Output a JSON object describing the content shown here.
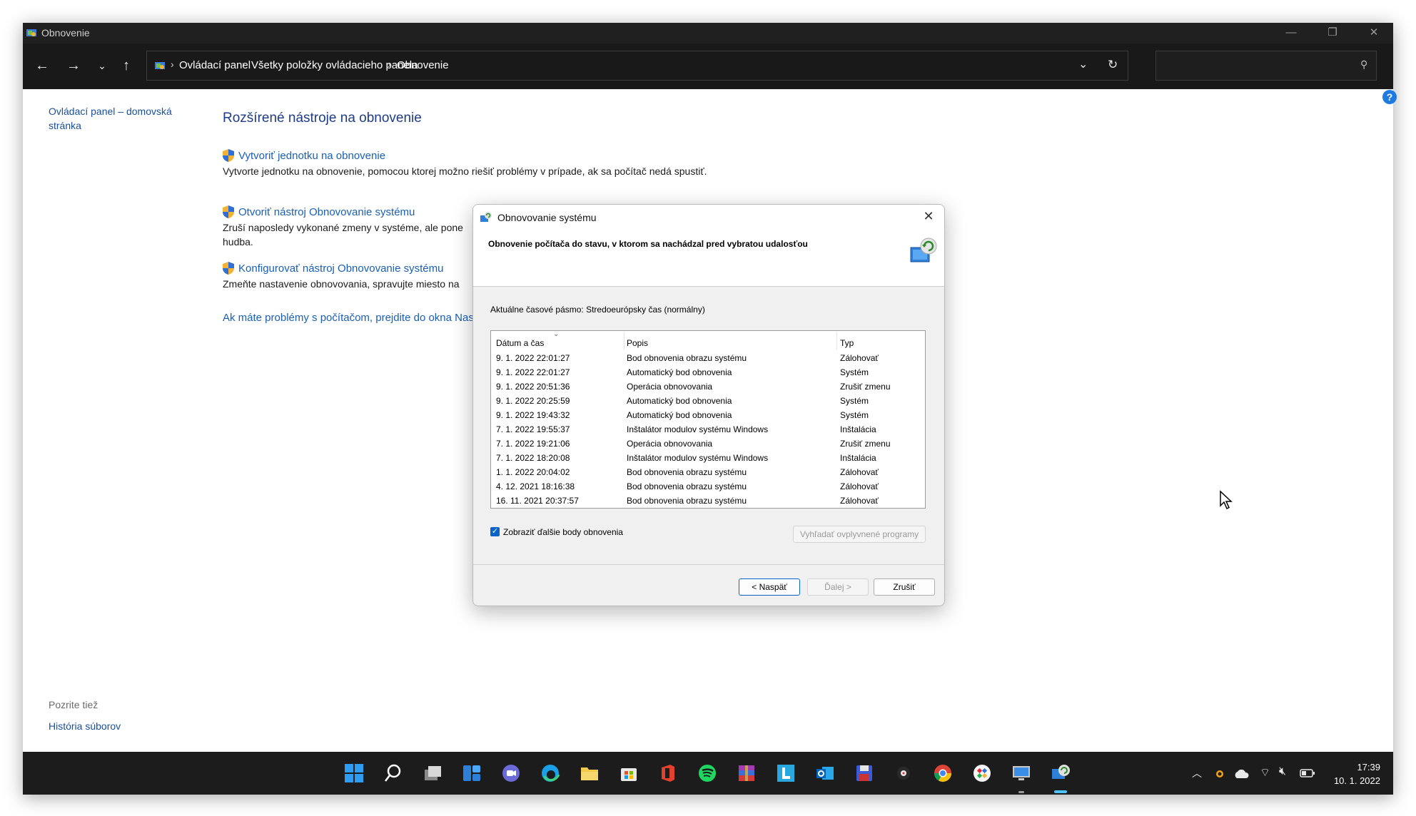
{
  "window": {
    "title": "Obnovenie"
  },
  "address_bar": {
    "crumbs": [
      "Ovládací panel",
      "Všetky položky ovládacieho panela",
      "Obnovenie"
    ],
    "search_placeholder": ""
  },
  "sidebar": {
    "home_link": "Ovládací panel – domovská stránka",
    "see_also_label": "Pozrite tiež",
    "file_history_link": "História súborov"
  },
  "main": {
    "heading": "Rozšírené nástroje na obnovenie",
    "tasks": [
      {
        "link": "Vytvoriť jednotku na obnovenie",
        "desc": "Vytvorte jednotku na obnovenie, pomocou ktorej možno riešiť problémy v prípade, ak sa počítač nedá spustiť."
      },
      {
        "link": "Otvoriť nástroj Obnovovanie systému",
        "desc_line1": "Zruší naposledy vykonané zmeny v systéme, ale pone",
        "desc_line2": "hudba."
      },
      {
        "link": "Konfigurovať nástroj Obnovovanie systému",
        "desc": "Zmeňte nastavenie obnovovania, spravujte miesto na"
      }
    ],
    "troubleshoot_link": "Ak máte problémy s počítačom, prejdite do okna Nas"
  },
  "dialog": {
    "title": "Obnovovanie systému",
    "subtitle": "Obnovenie počítača do stavu, v ktorom sa nachádzal pred vybratou udalosťou",
    "timezone": "Aktuálne časové pásmo: Stredoeurópsky čas (normálny)",
    "columns": [
      "Dátum a čas",
      "Popis",
      "Typ"
    ],
    "rows": [
      [
        "9. 1. 2022 22:01:27",
        "Bod obnovenia obrazu systému",
        "Zálohovať"
      ],
      [
        "9. 1. 2022 22:01:27",
        "Automatický bod obnovenia",
        "Systém"
      ],
      [
        "9. 1. 2022 20:51:36",
        "Operácia obnovovania",
        "Zrušiť zmenu"
      ],
      [
        "9. 1. 2022 20:25:59",
        "Automatický bod obnovenia",
        "Systém"
      ],
      [
        "9. 1. 2022 19:43:32",
        "Automatický bod obnovenia",
        "Systém"
      ],
      [
        "7. 1. 2022 19:55:37",
        "Inštalátor modulov systému Windows",
        "Inštalácia"
      ],
      [
        "7. 1. 2022 19:21:06",
        "Operácia obnovovania",
        "Zrušiť zmenu"
      ],
      [
        "7. 1. 2022 18:20:08",
        "Inštalátor modulov systému Windows",
        "Inštalácia"
      ],
      [
        "1. 1. 2022 20:04:02",
        "Bod obnovenia obrazu systému",
        "Zálohovať"
      ],
      [
        "4. 12. 2021 18:16:38",
        "Bod obnovenia obrazu systému",
        "Zálohovať"
      ],
      [
        "16. 11. 2021 20:37:57",
        "Bod obnovenia obrazu systému",
        "Zálohovať"
      ]
    ],
    "show_more_label": "Zobraziť ďalšie body obnovenia",
    "show_more_checked": true,
    "scan_button": "Vyhľadať ovplyvnené programy",
    "back_button": "< Naspäť",
    "next_button": "Ďalej >",
    "cancel_button": "Zrušiť"
  },
  "taskbar": {
    "apps": [
      "start-icon",
      "search-icon",
      "task-view-icon",
      "widgets-icon",
      "chat-icon",
      "edge-icon",
      "file-explorer-icon",
      "store-icon",
      "office-icon",
      "spotify-icon",
      "winrar-icon",
      "l-app-icon",
      "outlook-icon",
      "save-app-icon",
      "media-app-icon",
      "chrome-icon",
      "colorful-app-icon",
      "remote-desktop-icon",
      "system-restore-icon"
    ],
    "time": "17:39",
    "date": "10. 1. 2022"
  },
  "colors": {
    "link": "#1a5fb4",
    "heading": "#1e3d86",
    "dark_chrome": "#191919",
    "accent": "#0a64c8"
  }
}
